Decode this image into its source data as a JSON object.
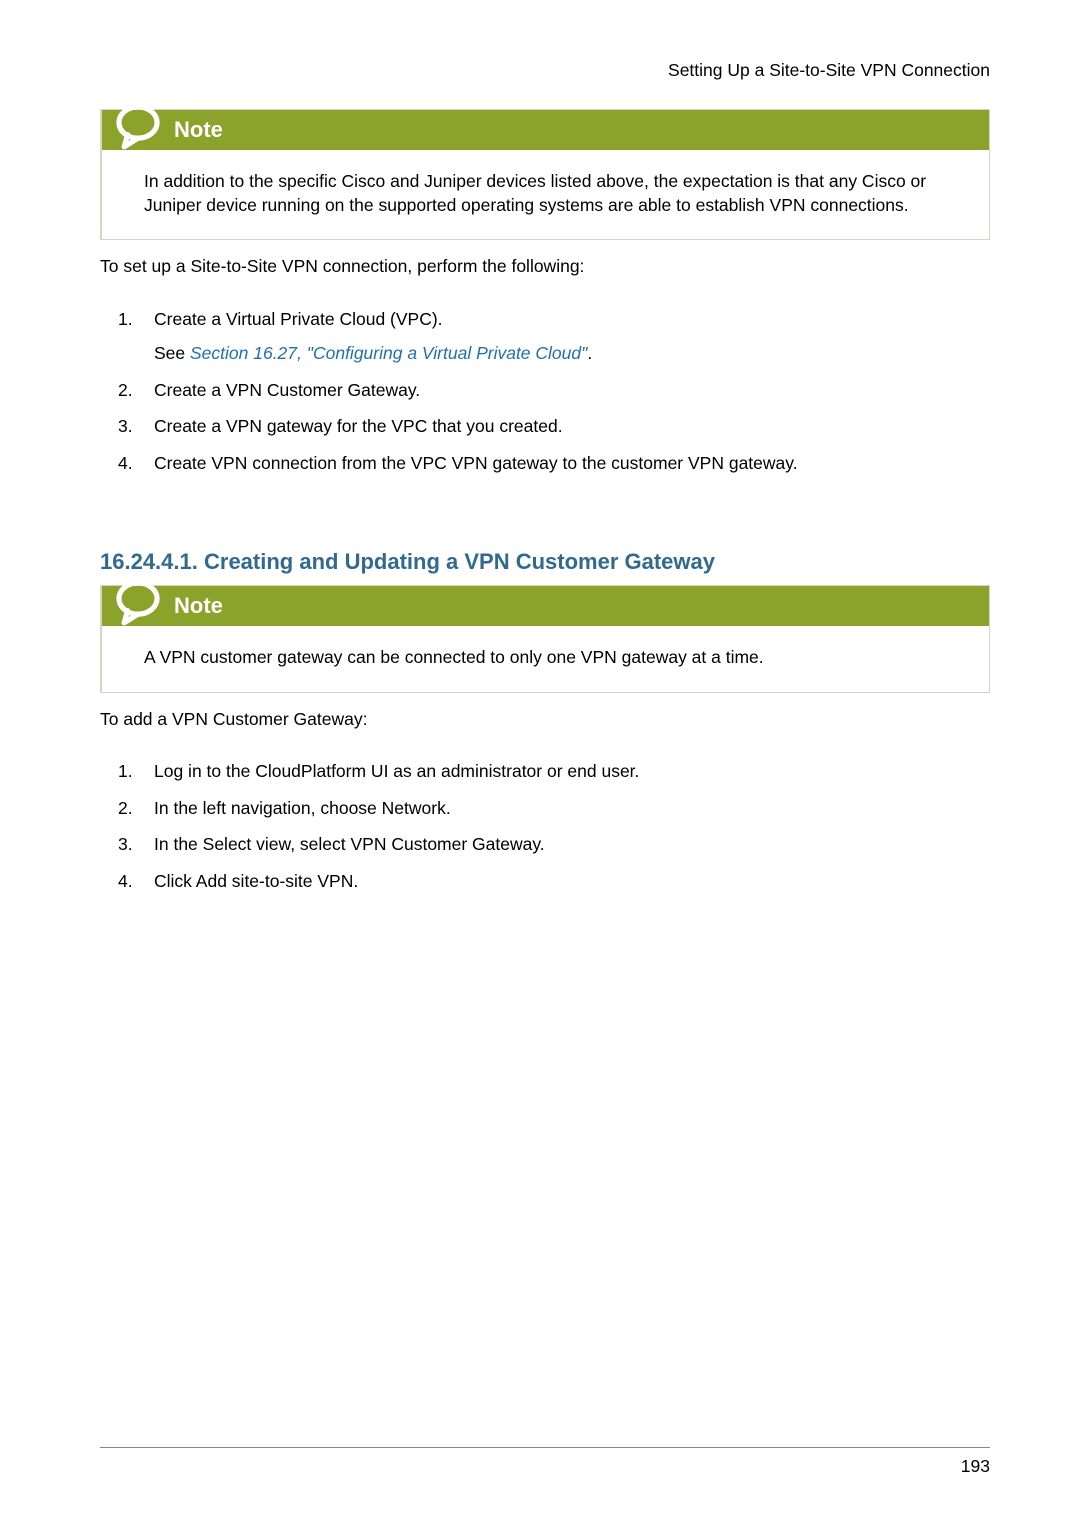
{
  "header": {
    "running_title": "Setting Up a Site-to-Site VPN Connection"
  },
  "note1": {
    "title": "Note",
    "body": "In addition to the specific Cisco and Juniper devices listed above, the expectation is that any Cisco or Juniper device running on the supported operating systems are able to establish VPN connections."
  },
  "intro": "To set up a Site-to-Site VPN connection, perform the following:",
  "steps1": [
    {
      "text": "Create a Virtual Private Cloud (VPC).",
      "sub_prefix": "See ",
      "sub_link": "Section 16.27, \"Configuring a Virtual Private Cloud\"",
      "sub_suffix": "."
    },
    {
      "text": "Create a VPN Customer Gateway."
    },
    {
      "text": "Create a VPN gateway for the VPC that you created."
    },
    {
      "text": "Create VPN connection from the VPC VPN gateway to the customer VPN gateway."
    }
  ],
  "section": {
    "number": "16.24.4.1.",
    "title": "Creating and Updating a VPN Customer Gateway"
  },
  "note2": {
    "title": "Note",
    "body": "A VPN customer gateway can be connected to only one VPN gateway at a time."
  },
  "intro2": "To add a VPN Customer Gateway:",
  "steps2": [
    {
      "text": "Log in to the CloudPlatform UI as an administrator or end user."
    },
    {
      "text": "In the left navigation, choose Network."
    },
    {
      "text": "In the Select view, select VPN Customer Gateway."
    },
    {
      "text": "Click Add site-to-site VPN."
    }
  ],
  "footer": {
    "page_number": "193"
  }
}
